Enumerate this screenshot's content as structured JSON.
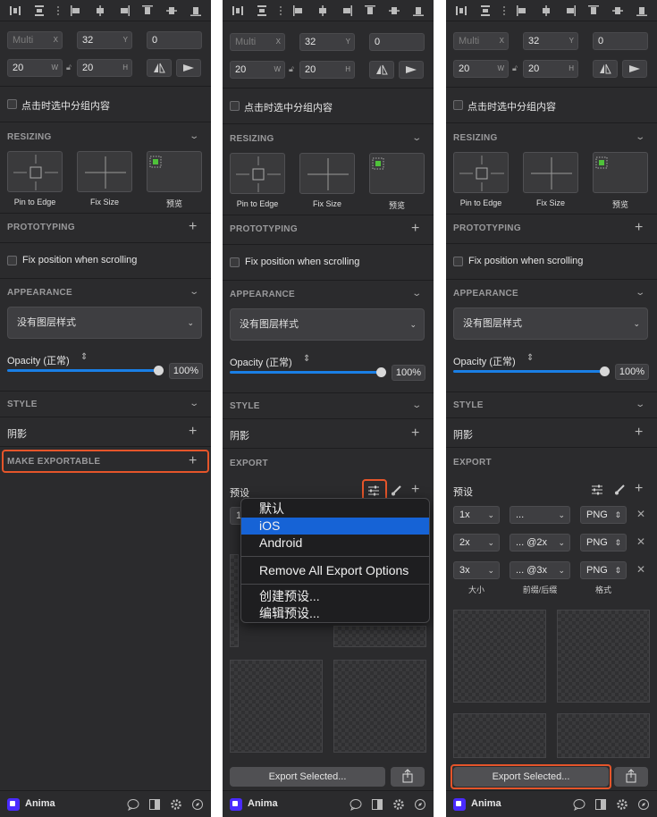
{
  "common": {
    "x_value": "Multi",
    "x_suffix": "X",
    "y_value": "32",
    "y_suffix": "Y",
    "rotation_value": "0",
    "w_value": "20",
    "w_suffix": "W",
    "h_value": "20",
    "h_suffix": "H",
    "group_checkbox_label": "点击时选中分组内容",
    "resizing_title": "RESIZING",
    "resize_labels": [
      "Pin to Edge",
      "Fix Size",
      "预览"
    ],
    "prototyping_title": "PROTOTYPING",
    "fix_position_label": "Fix position when scrolling",
    "appearance_title": "APPEARANCE",
    "layer_style": "没有图层样式",
    "opacity_label": "Opacity (正常)",
    "opacity_value": "100%",
    "opacity_fraction": 1.0,
    "style_title": "STYLE",
    "shadow_label": "阴影",
    "app_name": "Anima",
    "accent_color": "#1a7fe6",
    "highlight_color": "#e5552a"
  },
  "panel1": {
    "make_exportable": "MAKE EXPORTABLE"
  },
  "panel2": {
    "export_title": "EXPORT",
    "presets_label": "预设",
    "partial_value": "1",
    "menu_items": [
      "默认",
      "iOS",
      "Android",
      "Remove All Export Options",
      "创建预设...",
      "编辑预设..."
    ],
    "selected_menu_item": "iOS",
    "export_selected": "Export Selected..."
  },
  "panel3": {
    "export_title": "EXPORT",
    "presets_label": "预设",
    "rows": [
      {
        "size": "1x",
        "suffix": "...",
        "format": "PNG"
      },
      {
        "size": "2x",
        "suffix": "... @2x",
        "format": "PNG"
      },
      {
        "size": "3x",
        "suffix": "... @3x",
        "format": "PNG"
      }
    ],
    "col_labels": [
      "大小",
      "前缀/后缀",
      "格式"
    ],
    "export_selected": "Export Selected..."
  }
}
